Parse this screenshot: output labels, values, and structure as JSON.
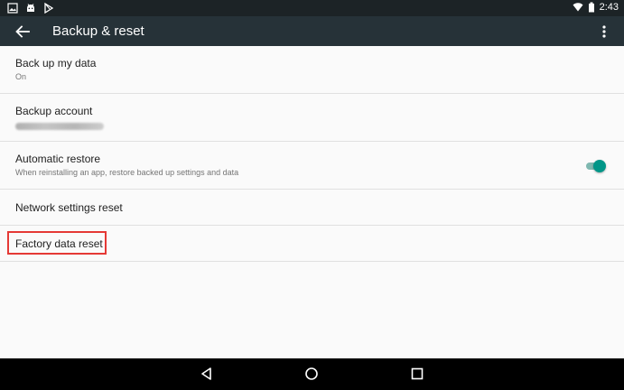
{
  "status_bar": {
    "time": "2:43",
    "left_icons": [
      "image-icon",
      "android-icon",
      "play-store-icon"
    ],
    "right_icons": [
      "wifi-icon",
      "battery-icon"
    ]
  },
  "app_bar": {
    "title": "Backup & reset",
    "back_icon": "arrow-back-icon",
    "menu_icon": "more-vert-icon",
    "background_color": "#263238"
  },
  "settings": [
    {
      "title": "Back up my data",
      "subtitle": "On"
    },
    {
      "title": "Backup account",
      "subtitle": ""
    },
    {
      "title": "Automatic restore",
      "subtitle": "When reinstalling an app, restore backed up settings and data",
      "toggle": true
    },
    {
      "title": "Network settings reset"
    },
    {
      "title": "Factory data reset",
      "highlighted": true
    }
  ],
  "accent_color": "#009688",
  "highlight_color": "#e53935",
  "nav_bar": {
    "icons": [
      "back-triangle-icon",
      "home-circle-icon",
      "recents-square-icon"
    ]
  }
}
